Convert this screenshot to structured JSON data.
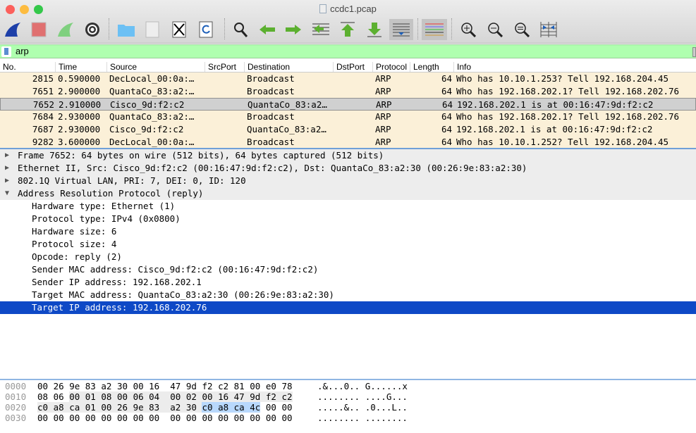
{
  "window": {
    "title": "ccdc1.pcap"
  },
  "filter": {
    "value": "arp"
  },
  "columns": [
    "No.",
    "Time",
    "Source",
    "SrcPort",
    "Destination",
    "DstPort",
    "Protocol",
    "Length",
    "Info"
  ],
  "packets": [
    {
      "no": "2815",
      "time": "0.590000",
      "src": "DecLocal_00:0a:…",
      "srcport": "",
      "dst": "Broadcast",
      "dstport": "",
      "proto": "ARP",
      "len": "64",
      "info": "Who has 10.10.1.253? Tell 192.168.204.45"
    },
    {
      "no": "7651",
      "time": "2.900000",
      "src": "QuantaCo_83:a2:…",
      "srcport": "",
      "dst": "Broadcast",
      "dstport": "",
      "proto": "ARP",
      "len": "64",
      "info": "Who has 192.168.202.1? Tell 192.168.202.76"
    },
    {
      "no": "7652",
      "time": "2.910000",
      "src": "Cisco_9d:f2:c2",
      "srcport": "",
      "dst": "QuantaCo_83:a2…",
      "dstport": "",
      "proto": "ARP",
      "len": "64",
      "info": "192.168.202.1 is at 00:16:47:9d:f2:c2",
      "selected": true
    },
    {
      "no": "7684",
      "time": "2.930000",
      "src": "QuantaCo_83:a2:…",
      "srcport": "",
      "dst": "Broadcast",
      "dstport": "",
      "proto": "ARP",
      "len": "64",
      "info": "Who has 192.168.202.1? Tell 192.168.202.76"
    },
    {
      "no": "7687",
      "time": "2.930000",
      "src": "Cisco_9d:f2:c2",
      "srcport": "",
      "dst": "QuantaCo_83:a2…",
      "dstport": "",
      "proto": "ARP",
      "len": "64",
      "info": "192.168.202.1 is at 00:16:47:9d:f2:c2"
    },
    {
      "no": "9282",
      "time": "3.600000",
      "src": "DecLocal_00:0a:…",
      "srcport": "",
      "dst": "Broadcast",
      "dstport": "",
      "proto": "ARP",
      "len": "64",
      "info": "Who has 10.10.1.252? Tell 192.168.204.45"
    }
  ],
  "details": [
    {
      "text": "Frame 7652: 64 bytes on wire (512 bits), 64 bytes captured (512 bits)",
      "level": 0,
      "expanded": false
    },
    {
      "text": "Ethernet II, Src: Cisco_9d:f2:c2 (00:16:47:9d:f2:c2), Dst: QuantaCo_83:a2:30 (00:26:9e:83:a2:30)",
      "level": 0,
      "expanded": false
    },
    {
      "text": "802.1Q Virtual LAN, PRI: 7, DEI: 0, ID: 120",
      "level": 0,
      "expanded": false
    },
    {
      "text": "Address Resolution Protocol (reply)",
      "level": 0,
      "expanded": true
    },
    {
      "text": "Hardware type: Ethernet (1)",
      "level": 1
    },
    {
      "text": "Protocol type: IPv4 (0x0800)",
      "level": 1
    },
    {
      "text": "Hardware size: 6",
      "level": 1
    },
    {
      "text": "Protocol size: 4",
      "level": 1
    },
    {
      "text": "Opcode: reply (2)",
      "level": 1
    },
    {
      "text": "Sender MAC address: Cisco_9d:f2:c2 (00:16:47:9d:f2:c2)",
      "level": 1
    },
    {
      "text": "Sender IP address: 192.168.202.1",
      "level": 1
    },
    {
      "text": "Target MAC address: QuantaCo_83:a2:30 (00:26:9e:83:a2:30)",
      "level": 1
    },
    {
      "text": "Target IP address: 192.168.202.76",
      "level": 1,
      "selected": true
    }
  ],
  "hex": {
    "field_range": [
      18,
      45
    ],
    "selected_range": [
      42,
      45
    ],
    "rows": [
      {
        "offset": "0000",
        "bytes": [
          "00",
          "26",
          "9e",
          "83",
          "a2",
          "30",
          "00",
          "16",
          "47",
          "9d",
          "f2",
          "c2",
          "81",
          "00",
          "e0",
          "78"
        ],
        "ascii": ".&...0.. G......x"
      },
      {
        "offset": "0010",
        "bytes": [
          "08",
          "06",
          "00",
          "01",
          "08",
          "00",
          "06",
          "04",
          "00",
          "02",
          "00",
          "16",
          "47",
          "9d",
          "f2",
          "c2"
        ],
        "ascii": "........ ....G..."
      },
      {
        "offset": "0020",
        "bytes": [
          "c0",
          "a8",
          "ca",
          "01",
          "00",
          "26",
          "9e",
          "83",
          "a2",
          "30",
          "c0",
          "a8",
          "ca",
          "4c",
          "00",
          "00"
        ],
        "ascii": ".....&.. .0...L.."
      },
      {
        "offset": "0030",
        "bytes": [
          "00",
          "00",
          "00",
          "00",
          "00",
          "00",
          "00",
          "00",
          "00",
          "00",
          "00",
          "00",
          "00",
          "00",
          "00",
          "00"
        ],
        "ascii": "........ ........"
      }
    ]
  }
}
